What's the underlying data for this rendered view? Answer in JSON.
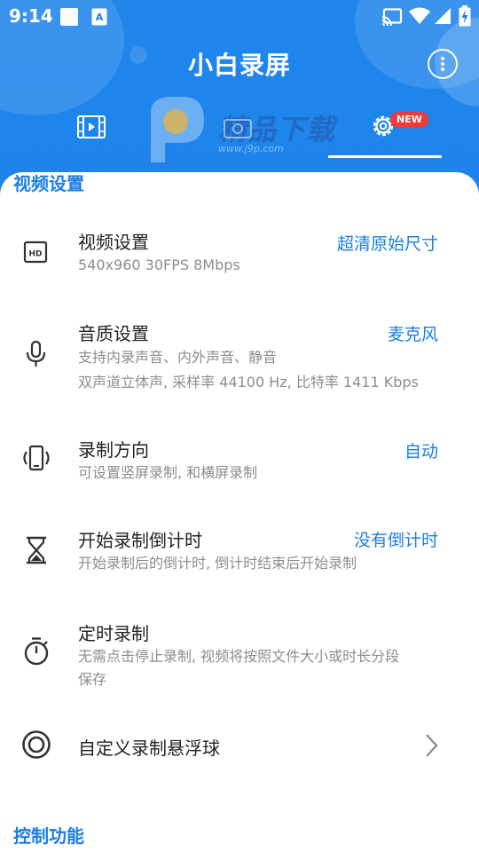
{
  "status_bar": {
    "time": "9:14",
    "icons": [
      "notification-square-icon",
      "font-a-icon",
      "cast-icon",
      "wifi-icon",
      "signal-icon",
      "battery-charging-icon"
    ]
  },
  "app": {
    "title": "小白录屏",
    "more_icon": "more-vertical-icon"
  },
  "tabs": [
    {
      "name": "videos",
      "icon": "film-icon",
      "selected": false
    },
    {
      "name": "camera",
      "icon": "camera-icon",
      "selected": false
    },
    {
      "name": "settings",
      "icon": "gear-icon",
      "selected": true,
      "badge": "NEW"
    }
  ],
  "watermark": {
    "text": "精品下载",
    "url": "www.j9p.com"
  },
  "sections": [
    {
      "title": "视频设置",
      "rows": [
        {
          "icon": "hd-icon",
          "title": "视频设置",
          "subtitle": [
            "540x960  30FPS  8Mbps"
          ],
          "value": "超清原始尺寸"
        },
        {
          "icon": "microphone-icon",
          "title": "音质设置",
          "subtitle": [
            "支持内录声音、内外声音、静音",
            "双声道立体声, 采样率 44100 Hz, 比特率 1411 Kbps"
          ],
          "value": "麦克风"
        },
        {
          "icon": "screen-rotation-icon",
          "title": "录制方向",
          "subtitle": [
            "可设置竖屏录制, 和横屏录制"
          ],
          "value": "自动"
        },
        {
          "icon": "hourglass-icon",
          "title": "开始录制倒计时",
          "subtitle": [
            "开始录制后的倒计时, 倒计时结束后开始录制"
          ],
          "value": "没有倒计时"
        },
        {
          "icon": "timer-icon",
          "title": "定时录制",
          "subtitle": [
            "无需点击停止录制, 视频将按照文件大小或时长分段",
            "保存"
          ],
          "value": ""
        },
        {
          "icon": "target-circle-icon",
          "title": "自定义录制悬浮球",
          "subtitle": [],
          "value": "",
          "chevron": "chevron-right-icon"
        }
      ]
    },
    {
      "title": "控制功能",
      "rows": []
    }
  ],
  "colors": {
    "primary": "#1a7ee6",
    "badge": "#ee3a3a",
    "text": "#222222",
    "subtext": "#8d8d8d",
    "icon": "#333333"
  }
}
